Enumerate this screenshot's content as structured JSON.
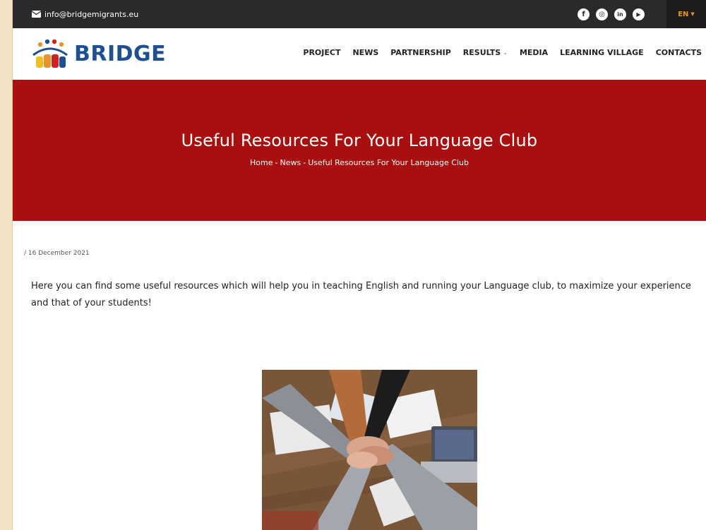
{
  "topbar": {
    "email": "info@bridgemigrants.eu",
    "socials": [
      {
        "icon": "facebook-icon",
        "glyph": "f"
      },
      {
        "icon": "instagram-icon",
        "glyph": "◎"
      },
      {
        "icon": "linkedin-icon",
        "glyph": "in"
      },
      {
        "icon": "youtube-icon",
        "glyph": "▶"
      }
    ],
    "language": "EN"
  },
  "header": {
    "logo_text": "BRIDGE",
    "nav": [
      {
        "label": "PROJECT"
      },
      {
        "label": "NEWS"
      },
      {
        "label": "PARTNERSHIP"
      },
      {
        "label": "RESULTS",
        "dropdown": true
      },
      {
        "label": "MEDIA"
      },
      {
        "label": "LEARNING VILLAGE"
      },
      {
        "label": "CONTACTS"
      }
    ]
  },
  "hero": {
    "title": "Useful Resources For Your Language Club",
    "breadcrumb": [
      "Home",
      "-",
      "News",
      "-",
      "Useful Resources For Your Language Club"
    ]
  },
  "article": {
    "date": "/ 16 December 2021",
    "intro": "Here you can find some useful resources which will help you in teaching English and running your Language club, to maximize your experience and that of your students!"
  },
  "colors": {
    "hero_bg": "#a90f0f",
    "topbar_bg": "#2a2a2a",
    "logo_blue": "#1f4f8f",
    "lang_accent": "#e7942a"
  }
}
